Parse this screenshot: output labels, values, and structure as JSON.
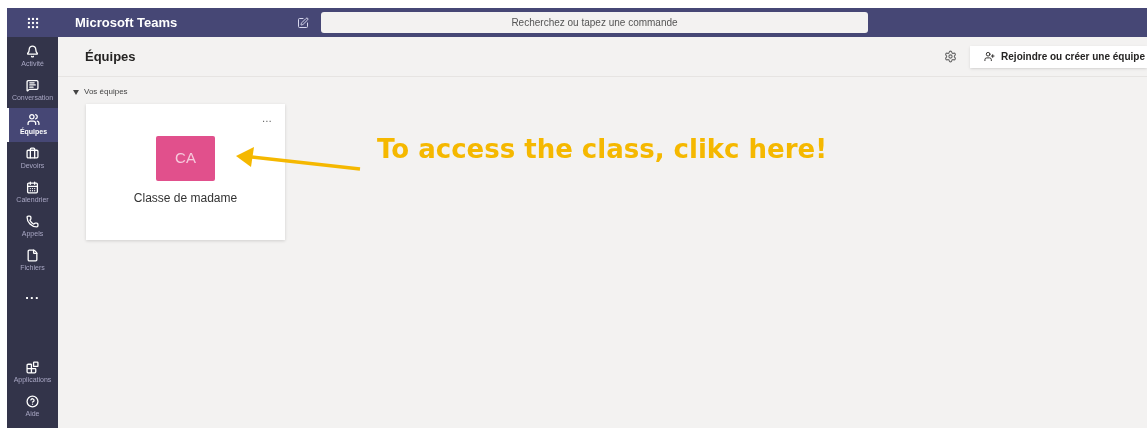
{
  "top_bar": {
    "app_name": "Microsoft Teams",
    "search": {
      "placeholder": "Recherchez ou tapez une commande"
    }
  },
  "sidebar": {
    "items": [
      {
        "kind": "activity",
        "label": "Activité",
        "selected": false
      },
      {
        "kind": "chat",
        "label": "Conversation",
        "selected": false
      },
      {
        "kind": "teams",
        "label": "Équipes",
        "selected": true
      },
      {
        "kind": "assignments",
        "label": "Devoirs",
        "selected": false
      },
      {
        "kind": "calendar",
        "label": "Calendrier",
        "selected": false
      },
      {
        "kind": "calls",
        "label": "Appels",
        "selected": false
      },
      {
        "kind": "files",
        "label": "Fichiers",
        "selected": false
      },
      {
        "kind": "more",
        "label": "..."
      }
    ],
    "bottom_items": [
      {
        "kind": "apps",
        "label": "Applications",
        "selected": false
      },
      {
        "kind": "help",
        "label": "Aide",
        "selected": false
      }
    ]
  },
  "header": {
    "title": "Équipes",
    "join_button": "Rejoindre ou créer une équipe"
  },
  "section": {
    "label": "Vos équipes",
    "expanded": true
  },
  "teams": [
    {
      "initials": "CA",
      "name": "Classe de madame",
      "color": "#e1508c",
      "menu": "..."
    }
  ],
  "annotation": {
    "text": "To access the class, clikc here!"
  }
}
